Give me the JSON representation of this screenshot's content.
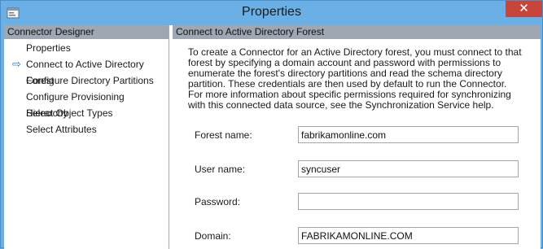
{
  "window": {
    "title": "Properties",
    "close_glyph": "✕",
    "app_icon": "properties-window-icon"
  },
  "left_pane": {
    "header": "Connector Designer",
    "selected_arrow": "⇨",
    "items": [
      {
        "label": "Properties"
      },
      {
        "label": "Connect to Active Directory Forest",
        "selected": true
      },
      {
        "label": "Configure Directory Partitions"
      },
      {
        "label": "Configure Provisioning Hierarchy"
      },
      {
        "label": "Select Object Types"
      },
      {
        "label": "Select Attributes"
      }
    ]
  },
  "right_pane": {
    "header": "Connect to Active Directory Forest",
    "description": "To create a Connector for an Active Directory forest, you must connect to that forest by specifying a domain account and password with permissions to enumerate the forest's directory partitions and read the schema directory partition. These credentials are then used by default to run the Connector. For more information about specific permissions required for synchronizing with this connected data source, see the Synchronization Service help.",
    "fields": {
      "forest_name": {
        "label": "Forest name:",
        "value": "fabrikamonline.com"
      },
      "user_name": {
        "label": "User name:",
        "value": "syncuser"
      },
      "password": {
        "label": "Password:",
        "value": ""
      },
      "domain": {
        "label": "Domain:",
        "value": "FABRIKAMONLINE.COM"
      }
    }
  },
  "colors": {
    "frame": "#6ab0e6",
    "header_bar": "#9fa7b3",
    "close_button": "#c7453a",
    "arrow": "#2d6fc0"
  }
}
